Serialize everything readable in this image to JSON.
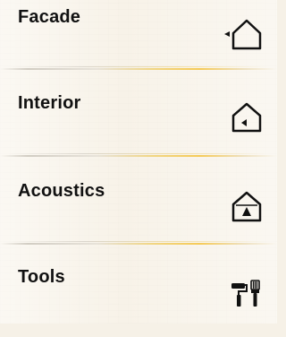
{
  "menu": {
    "items": [
      {
        "label": "Facade",
        "icon": "house-outline-arrow-icon"
      },
      {
        "label": "Interior",
        "icon": "house-interior-icon"
      },
      {
        "label": "Acoustics",
        "icon": "house-acoustics-icon"
      },
      {
        "label": "Tools",
        "icon": "tools-paint-roller-brush-icon"
      }
    ]
  }
}
